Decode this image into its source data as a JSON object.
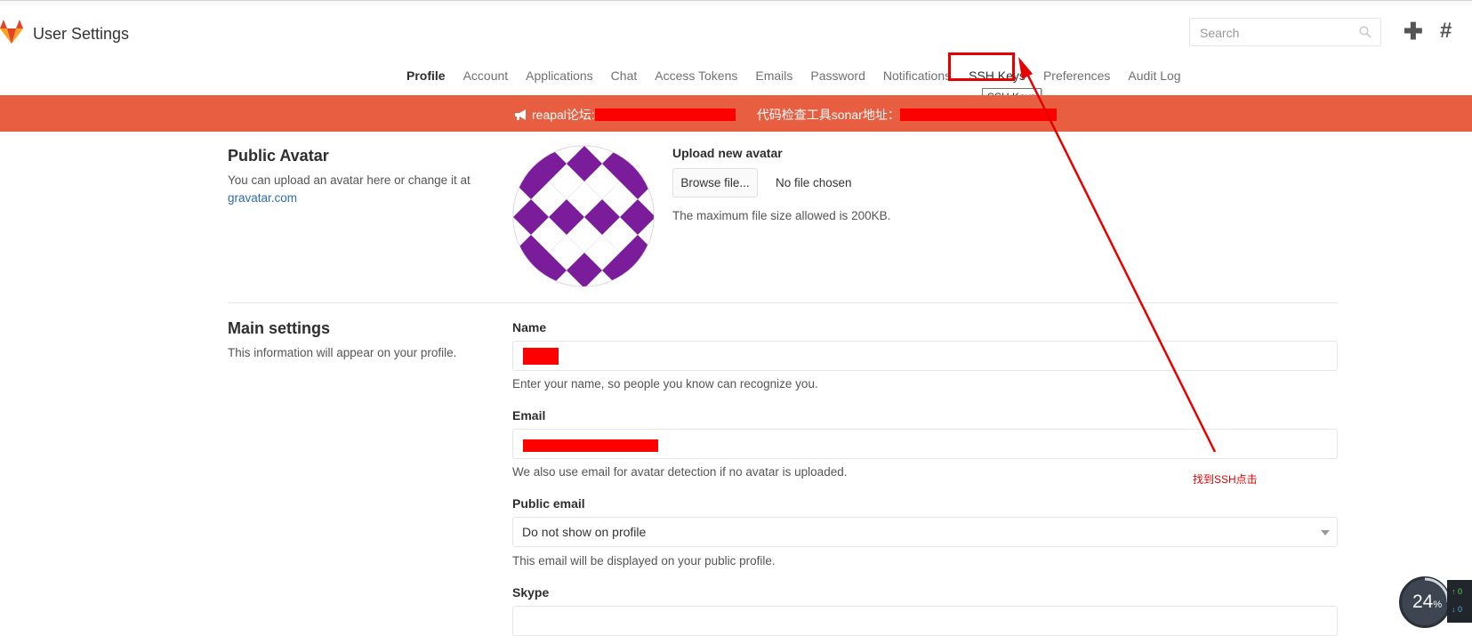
{
  "header": {
    "title": "User Settings",
    "search_placeholder": "Search",
    "plus_glyph": "✚",
    "hash_glyph": "#",
    "accent_color": "#e75e40"
  },
  "nav": {
    "items": [
      "Profile",
      "Account",
      "Applications",
      "Chat",
      "Access Tokens",
      "Emails",
      "Password",
      "Notifications",
      "SSH Keys",
      "Preferences",
      "Audit Log"
    ],
    "active": "Profile",
    "tooltip": "SSH Keys"
  },
  "banner": {
    "icon": "megaphone-icon",
    "text1": "reapal论坛:",
    "text2": "代码检查工具sonar地址："
  },
  "avatar_section": {
    "title": "Public Avatar",
    "desc": "You can upload an avatar here or change it at",
    "link": "gravatar.com",
    "upload_label": "Upload new avatar",
    "browse_button": "Browse file...",
    "no_file": "No file chosen",
    "max_size": "The maximum file size allowed is 200KB."
  },
  "main_settings": {
    "title": "Main settings",
    "desc": "This information will appear on your profile.",
    "name_label": "Name",
    "name_help": "Enter your name, so people you know can recognize you.",
    "email_label": "Email",
    "email_help": "We also use email for avatar detection if no avatar is uploaded.",
    "public_email_label": "Public email",
    "public_email_value": "Do not show on profile",
    "public_email_help": "This email will be displayed on your public profile.",
    "skype_label": "Skype"
  },
  "annotation": {
    "text": "找到SSH点击",
    "color": "#e60000"
  },
  "system_widget": {
    "percent": "24",
    "percent_sign": "%",
    "up_label": "0",
    "down_label": "0"
  }
}
